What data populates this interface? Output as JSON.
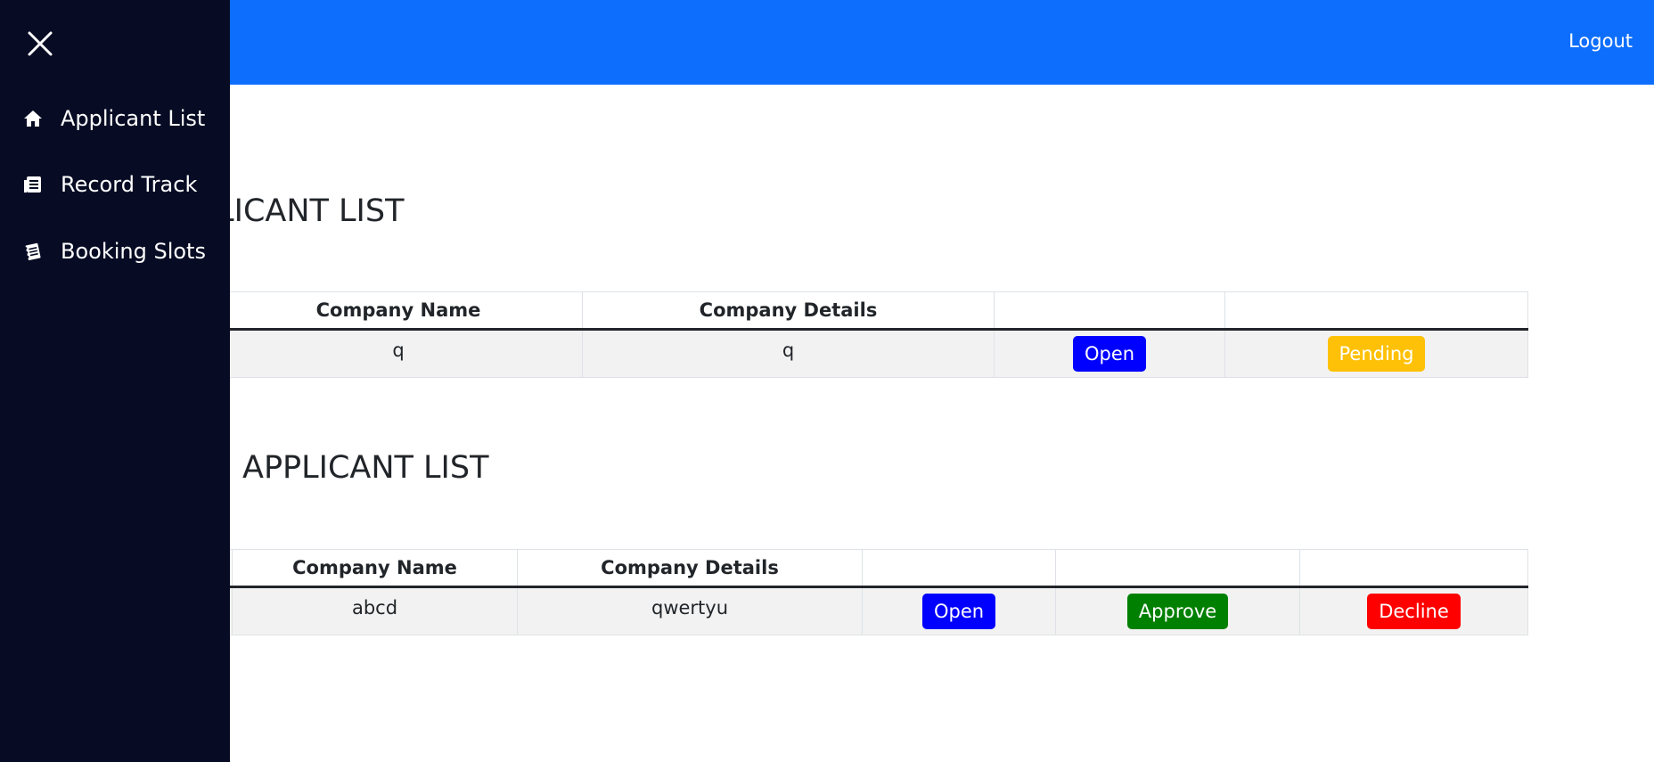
{
  "header": {
    "logout_label": "Logout"
  },
  "sidebar": {
    "items": [
      {
        "label": "Applicant List",
        "icon": "home-icon"
      },
      {
        "label": "Record Track",
        "icon": "document-list-icon"
      },
      {
        "label": "Booking Slots",
        "icon": "notebook-icon"
      }
    ]
  },
  "section1": {
    "title": "APPLICANT LIST",
    "columns": [
      "",
      "Company Name",
      "Company Details",
      "",
      ""
    ],
    "row": {
      "name": "q",
      "details": "q",
      "open_label": "Open",
      "status_label": "Pending"
    }
  },
  "section2": {
    "title": "APPLICANT LIST",
    "columns": [
      "",
      "Company Name",
      "Company Details",
      "",
      "",
      ""
    ],
    "row": {
      "name": "abcd",
      "details": "qwertyu",
      "open_label": "Open",
      "approve_label": "Approve",
      "decline_label": "Decline"
    }
  },
  "colors": {
    "topbar": "#0d6efd",
    "sidebar": "#070c24",
    "open_button": "#0000ff",
    "pending_button": "#ffc107",
    "approve_button": "#008000",
    "decline_button": "#ff0000"
  }
}
